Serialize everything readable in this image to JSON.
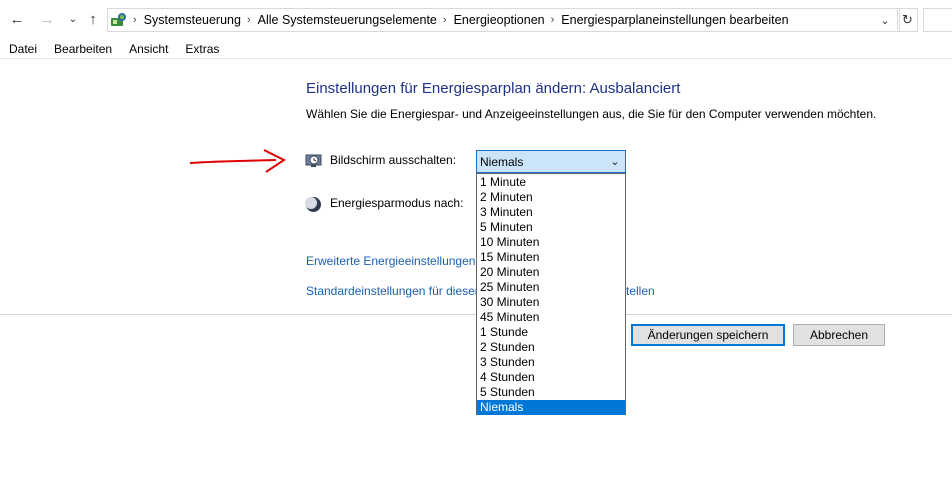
{
  "address_bar": {
    "breadcrumbs": [
      "Systemsteuerung",
      "Alle Systemsteuerungselemente",
      "Energieoptionen",
      "Energiesparplaneinstellungen bearbeiten"
    ]
  },
  "menu": [
    "Datei",
    "Bearbeiten",
    "Ansicht",
    "Extras"
  ],
  "main": {
    "title": "Einstellungen für Energiesparplan ändern: Ausbalanciert",
    "subtitle": "Wählen Sie die Energiespar- und Anzeigeeinstellungen aus, die Sie für den Computer verwenden möchten.",
    "display_off_label": "Bildschirm ausschalten:",
    "sleep_label": "Energiesparmodus nach:",
    "display_off_value": "Niemals",
    "link_advanced": "Erweiterte Energieeinstellungen ä",
    "link_defaults": "Standardeinstellungen für diesen",
    "link_defaults_tail": "tellen",
    "save_button": "Änderungen speichern",
    "cancel_button": "Abbrechen"
  },
  "dropdown": {
    "options": [
      "1 Minute",
      "2 Minuten",
      "3 Minuten",
      "5 Minuten",
      "10 Minuten",
      "15 Minuten",
      "20 Minuten",
      "25 Minuten",
      "30 Minuten",
      "45 Minuten",
      "1 Stunde",
      "2 Stunden",
      "3 Stunden",
      "4 Stunden",
      "5 Stunden",
      "Niemals"
    ],
    "selected_index": 15
  },
  "colors": {
    "title": "#1e3287",
    "link": "#1a5fb4",
    "selection": "#0078d7",
    "annotation_arrow": "#e00000"
  },
  "icons": {
    "back": "arrow-left-icon",
    "forward": "arrow-right-icon",
    "recent": "chevron-down-icon",
    "up": "arrow-up-icon",
    "location": "control-panel-icon",
    "refresh": "refresh-icon",
    "display": "monitor-clock-icon",
    "sleep": "moon-icon"
  }
}
